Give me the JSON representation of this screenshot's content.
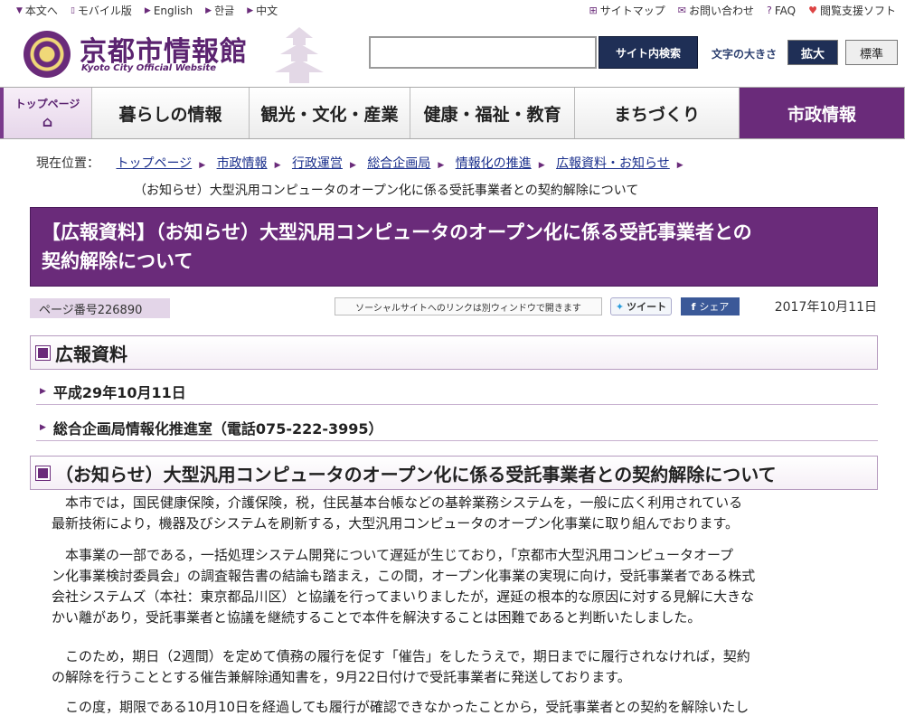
{
  "utility": {
    "left": [
      {
        "icon": "triangle-down-icon",
        "label": "本文へ"
      },
      {
        "icon": "mobile-icon",
        "label": "モバイル版"
      },
      {
        "icon": "triangle-right-icon",
        "label": "English"
      },
      {
        "icon": "triangle-right-icon",
        "label": "한글"
      },
      {
        "icon": "triangle-right-icon",
        "label": "中文"
      }
    ],
    "right": [
      {
        "icon": "sitemap-icon",
        "label": "サイトマップ"
      },
      {
        "icon": "mail-icon",
        "label": "お問い合わせ"
      },
      {
        "icon": "question-icon",
        "label": "FAQ"
      },
      {
        "icon": "heart-icon",
        "label": "閲覧支援ソフト"
      }
    ]
  },
  "header": {
    "title": "京都市情報館",
    "subtitle": "Kyoto City Official Website",
    "search_button": "サイト内検索",
    "search_value": "",
    "textsize_label": "文字の大きさ",
    "textsize_large": "拡大",
    "textsize_normal": "標準"
  },
  "nav": {
    "top_label": "トップページ",
    "tabs": [
      "暮らしの情報",
      "観光・文化・産業",
      "健康・福祉・教育",
      "まちづくり",
      "市政情報"
    ],
    "active_index": 4
  },
  "breadcrumb": {
    "label": "現在位置：",
    "items": [
      "トップページ",
      "市政情報",
      "行政運営",
      "総合企画局",
      "情報化の推進",
      "広報資料・お知らせ"
    ],
    "current": "（お知らせ）大型汎用コンピュータのオープン化に係る受託事業者との契約解除について"
  },
  "page": {
    "title_line1": "【広報資料】（お知らせ）大型汎用コンピュータのオープン化に係る受託事業者との",
    "title_line2": "契約解除について",
    "page_number": "ページ番号226890",
    "social_note": "ソーシャルサイトへのリンクは別ウィンドウで開きます",
    "tweet": "ツイート",
    "share": "シェア",
    "date": "2017年10月11日"
  },
  "content": {
    "section1_heading": "広報資料",
    "release_date": "平成29年10月11日",
    "contact": "総合企画局情報化推進室（電話075-222-3995）",
    "section2_heading": "（お知らせ）大型汎用コンピュータのオープン化に係る受託事業者との契約解除について",
    "para1_line1": "本市では，国民健康保険，介護保険，税，住民基本台帳などの基幹業務システムを，一般に広く利用されている",
    "para1_line2": "最新技術により，機器及びシステムを刷新する，大型汎用コンピュータのオープン化事業に取り組んでおります。",
    "para2_line1": "本事業の一部である，一括処理システム開発について遅延が生じており，「京都市大型汎用コンピュータオープ",
    "para2_line2": "ン化事業検討委員会」の調査報告書の結論も踏まえ，この間，オープン化事業の実現に向け，受託事業者である株式",
    "para2_line3": "会社システムズ（本社：東京都品川区）と協議を行ってまいりましたが，遅延の根本的な原因に対する見解に大きな",
    "para2_line4": "かい離があり，受託事業者と協議を継続することで本件を解決することは困難であると判断いたしました。",
    "para3_line1": "このため，期日（2週間）を定めて債務の履行を促す「催告」をしたうえで，期日までに履行されなければ，契約",
    "para3_line2": "の解除を行うこととする催告兼解除通知書を，9月22日付けで受託事業者に発送しております。",
    "para4_line1": "この度，期限である10月10日を経過しても履行が確認できなかったことから，受託事業者との契約を解除いたし"
  },
  "colors": {
    "brand_purple": "#6a2b7a",
    "search_navy": "#1f2f56",
    "link_blue": "#1a2f8c"
  }
}
